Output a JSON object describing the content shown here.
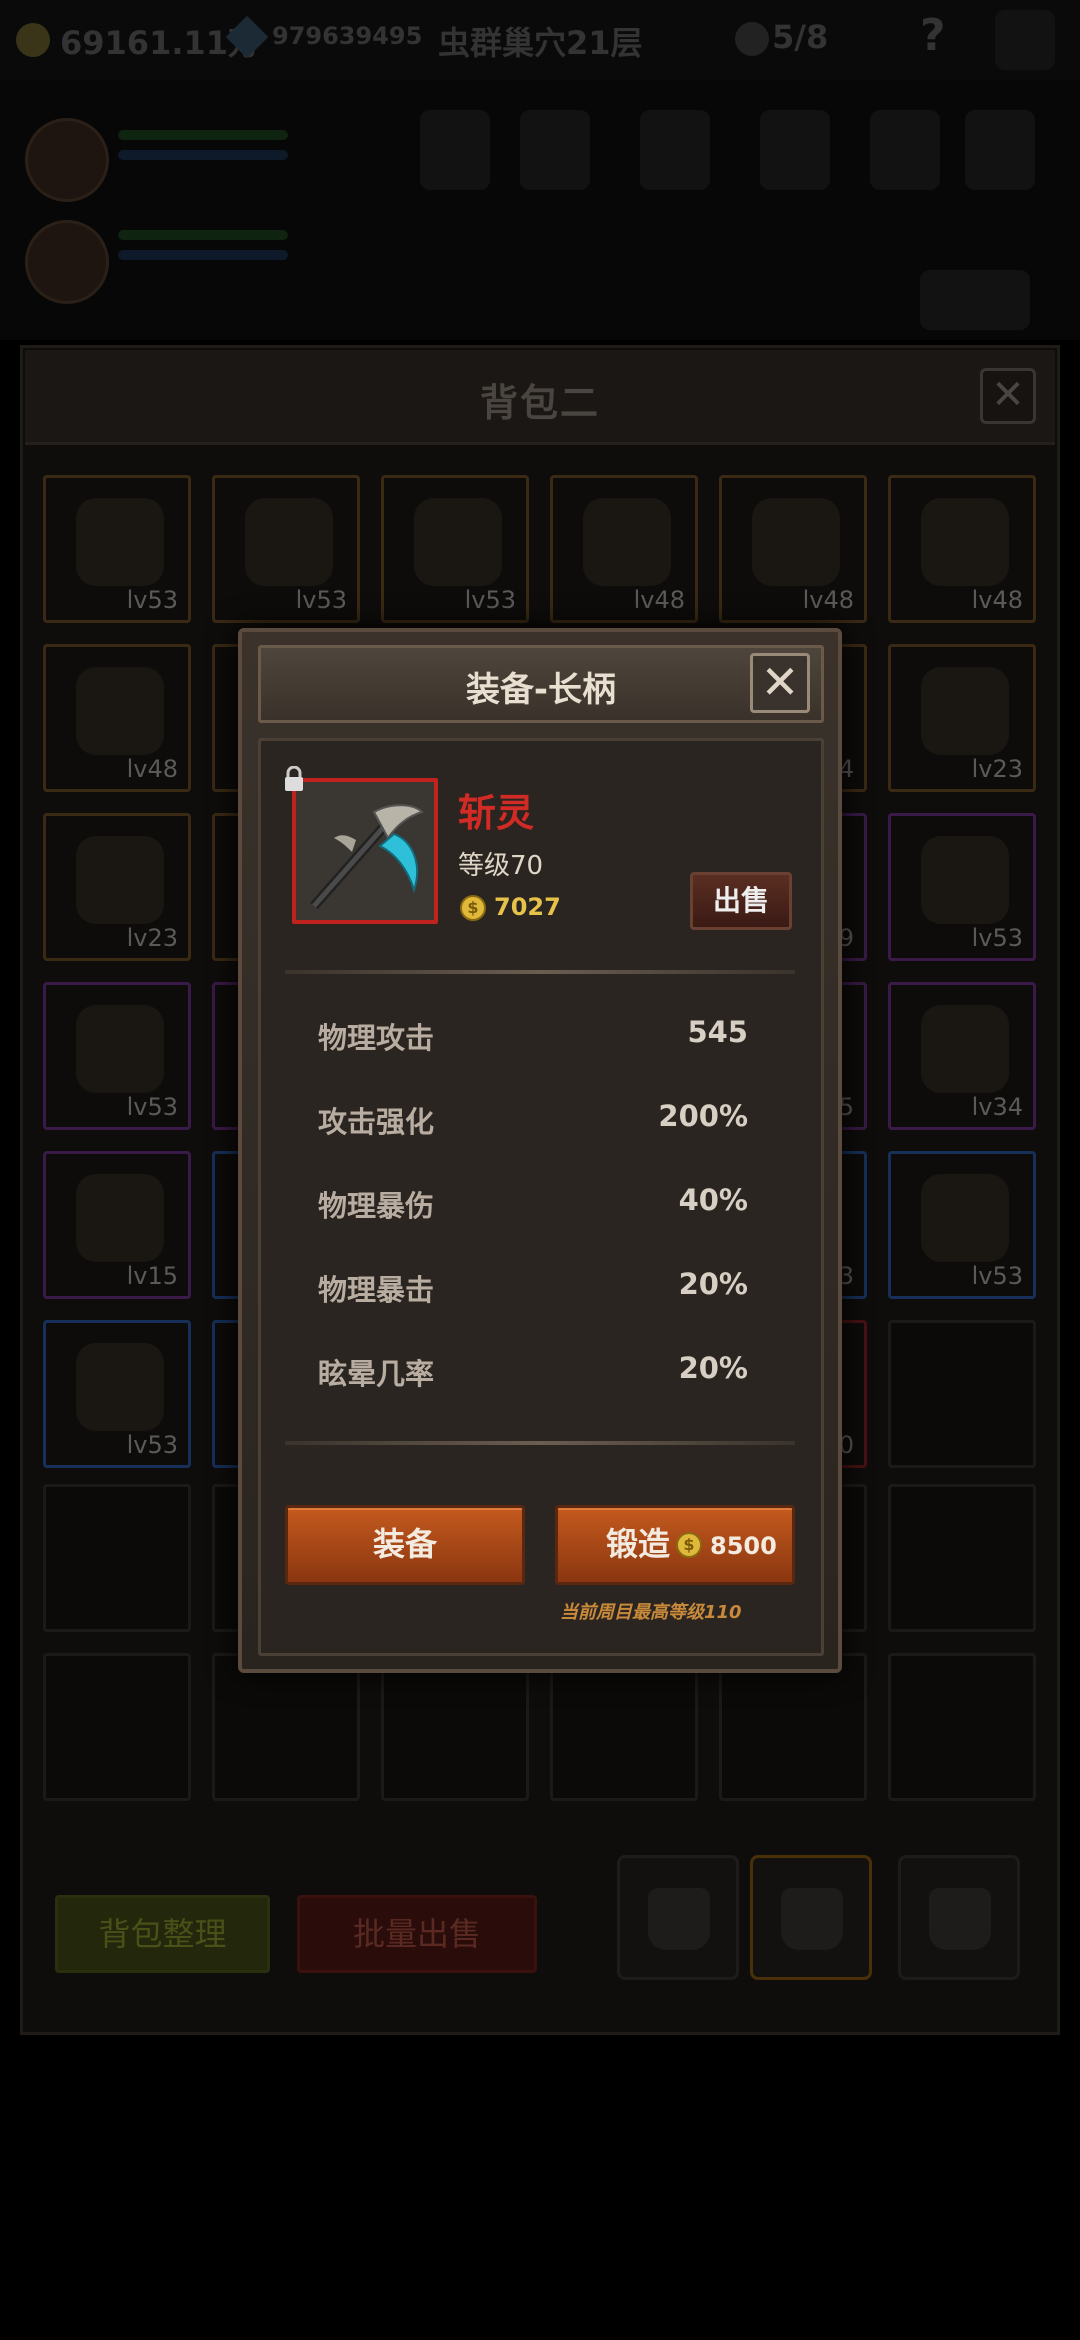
{
  "topbar": {
    "gold": "69161.11万",
    "gems": "979639495",
    "stage": "虫群巢穴21层",
    "skull_count": "5/8",
    "help": "?"
  },
  "bag": {
    "title": "背包二",
    "close": "✕",
    "cells": [
      {
        "lv": "lv53",
        "q": "gold"
      },
      {
        "lv": "lv53",
        "q": "gold"
      },
      {
        "lv": "lv53",
        "q": "gold"
      },
      {
        "lv": "lv48",
        "q": "gold"
      },
      {
        "lv": "lv48",
        "q": "gold"
      },
      {
        "lv": "lv48",
        "q": "gold"
      },
      {
        "lv": "lv48",
        "q": "gold"
      },
      {
        "lv": "",
        "q": "gold"
      },
      {
        "lv": "",
        "q": "gold"
      },
      {
        "lv": "",
        "q": "gold"
      },
      {
        "lv": "4",
        "q": "gold"
      },
      {
        "lv": "lv23",
        "q": "gold"
      },
      {
        "lv": "lv23",
        "q": "gold"
      },
      {
        "lv": "",
        "q": "gold"
      },
      {
        "lv": "",
        "q": "gold"
      },
      {
        "lv": "",
        "q": "gold"
      },
      {
        "lv": "9",
        "q": "purple"
      },
      {
        "lv": "lv53",
        "q": "purple"
      },
      {
        "lv": "lv53",
        "q": "purple"
      },
      {
        "lv": "",
        "q": "purple"
      },
      {
        "lv": "",
        "q": "purple"
      },
      {
        "lv": "",
        "q": "purple"
      },
      {
        "lv": "5",
        "q": "purple"
      },
      {
        "lv": "lv34",
        "q": "purple"
      },
      {
        "lv": "lv15",
        "q": "purple"
      },
      {
        "lv": "",
        "q": "blue"
      },
      {
        "lv": "",
        "q": "blue"
      },
      {
        "lv": "",
        "q": "blue"
      },
      {
        "lv": "3",
        "q": "blue"
      },
      {
        "lv": "lv53",
        "q": "blue"
      },
      {
        "lv": "lv53",
        "q": "blue"
      },
      {
        "lv": "",
        "q": "blue"
      },
      {
        "lv": "",
        "q": "blue"
      },
      {
        "lv": "",
        "q": "blue"
      },
      {
        "lv": "0",
        "q": "red"
      },
      {
        "lv": "",
        "q": "empty"
      }
    ],
    "sort_label": "背包整理",
    "batch_sell_label": "批量出售"
  },
  "modal": {
    "title": "装备-长柄",
    "close": "✕",
    "item_name": "斩灵",
    "item_level": "等级70",
    "gold_symbol": "$",
    "item_price": "7027",
    "sell_label": "出售",
    "stats": [
      {
        "name": "物理攻击",
        "value": "545"
      },
      {
        "name": "攻击强化",
        "value": "200%"
      },
      {
        "name": "物理暴伤",
        "value": "40%"
      },
      {
        "name": "物理暴击",
        "value": "20%"
      },
      {
        "name": "眩晕几率",
        "value": "20%"
      }
    ],
    "equip_label": "装备",
    "forge_label": "锻造",
    "forge_price": "8500",
    "note": "当前周目最高等级110"
  }
}
